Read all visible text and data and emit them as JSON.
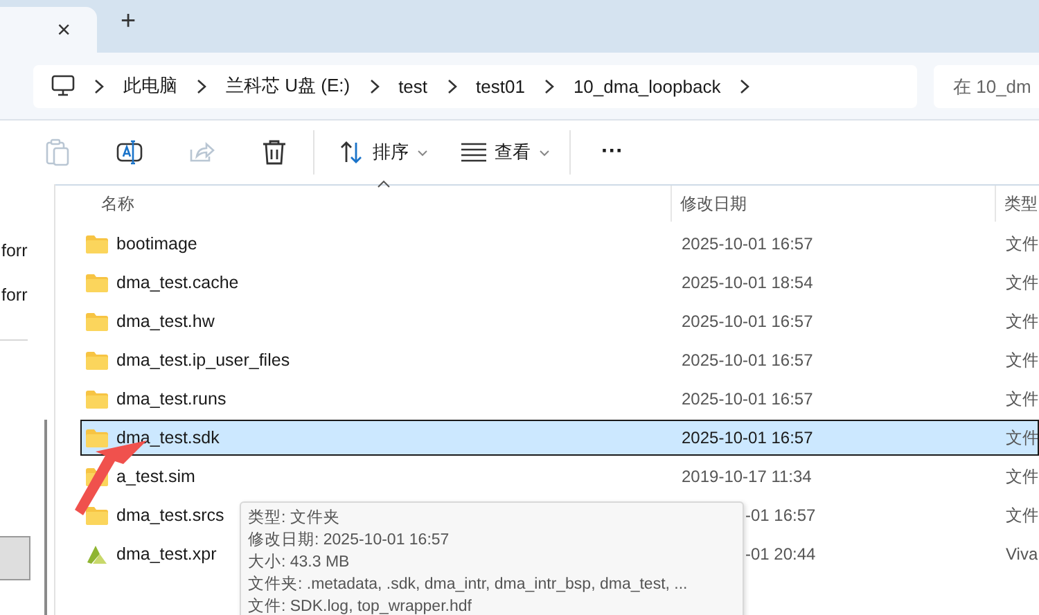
{
  "tab": {
    "close": "×",
    "new_tab": "+"
  },
  "breadcrumb": [
    "此电脑",
    "兰科芯 U盘 (E:)",
    "test",
    "test01",
    "10_dma_loopback"
  ],
  "search": {
    "placeholder": "在 10_dm"
  },
  "toolbar": [
    {
      "kind": "paste",
      "disabled": true
    },
    {
      "kind": "rename",
      "disabled": false
    },
    {
      "kind": "share",
      "disabled": true
    },
    {
      "kind": "delete",
      "disabled": false
    },
    {
      "kind": "divider"
    },
    {
      "kind": "sort",
      "label": "排序",
      "disabled": false
    },
    {
      "kind": "view",
      "label": "查看",
      "disabled": false
    },
    {
      "kind": "divider"
    },
    {
      "kind": "more",
      "label": "···",
      "disabled": false
    }
  ],
  "nav_pane": {
    "items": [
      "forr",
      "forr"
    ]
  },
  "columns": [
    "名称",
    "修改日期",
    "类型"
  ],
  "files": [
    {
      "name": "bootimage",
      "kind": "folder",
      "date": "2025-10-01 16:57",
      "type": "文件",
      "selected": false,
      "date_covered": false
    },
    {
      "name": "dma_test.cache",
      "kind": "folder",
      "date": "2025-10-01 18:54",
      "type": "文件",
      "selected": false,
      "date_covered": false
    },
    {
      "name": "dma_test.hw",
      "kind": "folder",
      "date": "2025-10-01 16:57",
      "type": "文件",
      "selected": false,
      "date_covered": false
    },
    {
      "name": "dma_test.ip_user_files",
      "kind": "folder",
      "date": "2025-10-01 16:57",
      "type": "文件",
      "selected": false,
      "date_covered": false
    },
    {
      "name": "dma_test.runs",
      "kind": "folder",
      "date": "2025-10-01 16:57",
      "type": "文件",
      "selected": false,
      "date_covered": false
    },
    {
      "name": "dma_test.sdk",
      "kind": "folder",
      "date": "2025-10-01 16:57",
      "type": "文件",
      "selected": true,
      "date_covered": false
    },
    {
      "name": "a_test.sim",
      "kind": "folder",
      "date": "2019-10-17 11:34",
      "type": "文件",
      "selected": false,
      "date_covered": false
    },
    {
      "name": "dma_test.srcs",
      "kind": "folder",
      "date": "-01 16:57",
      "type": "文件",
      "selected": false,
      "date_covered": true
    },
    {
      "name": "dma_test.xpr",
      "kind": "project",
      "date": "-01 20:44",
      "type": "Viva",
      "selected": false,
      "date_covered": true
    }
  ],
  "tooltip": [
    "类型: 文件夹",
    "修改日期: 2025-10-01 16:57",
    "大小: 43.3 MB",
    "文件夹: .metadata, .sdk, dma_intr, dma_intr_bsp, dma_test, ...",
    "文件: SDK.log, top_wrapper.hdf"
  ]
}
